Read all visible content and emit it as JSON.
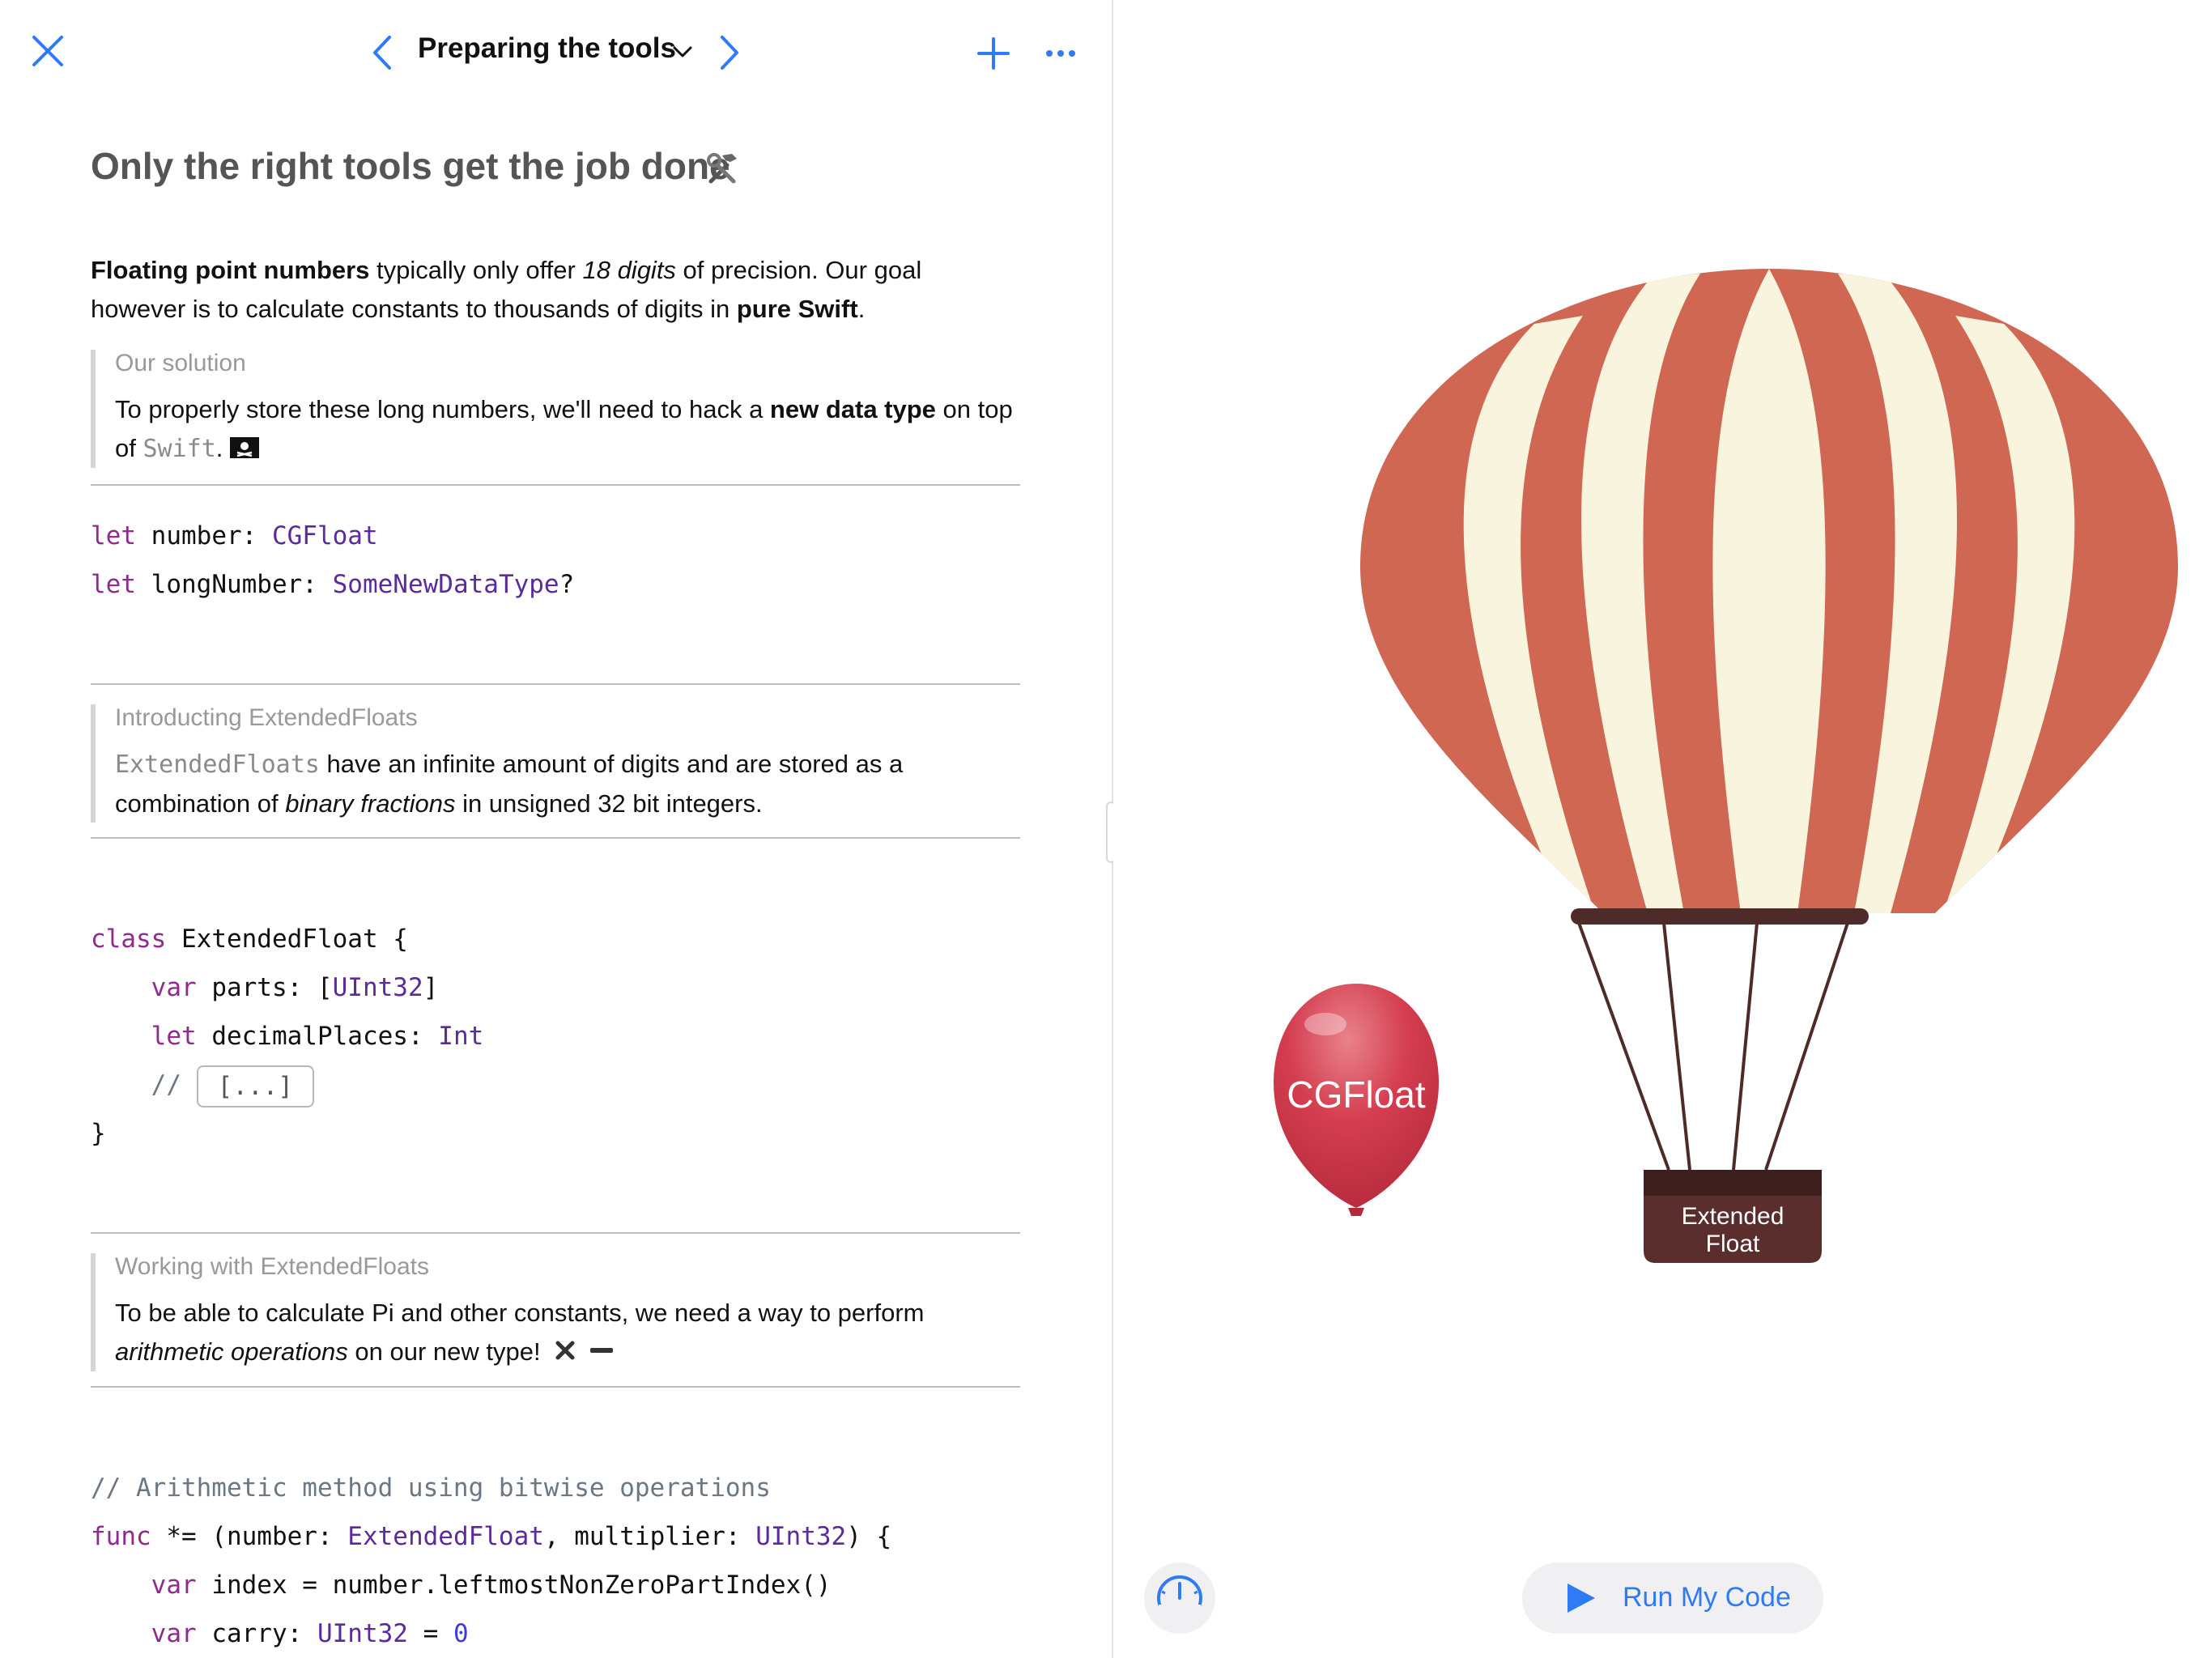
{
  "toolbar": {
    "title": "Preparing the tools",
    "accent_color": "#2f7bf5",
    "icons": [
      "close-icon",
      "chevron-left-icon",
      "chevron-down-icon",
      "chevron-right-icon",
      "plus-icon",
      "ellipsis-icon"
    ]
  },
  "page": {
    "heading": "Only the right tools get the job done",
    "heading_icon": "hammer-and-wrench-icon",
    "intro": {
      "p1_bold": "Floating point numbers",
      "p1_a": " typically only offer ",
      "p1_italic": "18 digits",
      "p1_b": " of precision. Our goal however is to calculate constants to thousands of digits in ",
      "p1_bold2": "pure Swift",
      "p1_c": "."
    },
    "callout1": {
      "title": "Our solution",
      "a": "To properly store these long numbers, we'll need to hack a ",
      "bold": "new data type",
      "b": " on top of ",
      "code": "Swift",
      "c": ".",
      "icon": "pirate-flag-icon"
    },
    "code1": {
      "l1_kw": "let",
      "l1_name": " number: ",
      "l1_type": "CGFloat",
      "l2_kw": "let",
      "l2_name": " longNumber: ",
      "l2_type": "SomeNewDataType",
      "l2_end": "?"
    },
    "callout2": {
      "title": "Introducting ExtendedFloats",
      "code": "ExtendedFloats",
      "a": " have an infinite amount of digits and are stored as a combination of ",
      "italic": "binary fractions",
      "b": " in unsigned 32 bit integers."
    },
    "code2": {
      "l1_kw": "class",
      "l1_rest": " ExtendedFloat {",
      "l2_kw": "var",
      "l2_name": " parts: [",
      "l2_type": "UInt32",
      "l2_end": "]",
      "l3_kw": "let",
      "l3_name": " decimalPlaces: ",
      "l3_type": "Int",
      "l4_comment": "//",
      "l4_placeholder": "[...]",
      "l5": "}"
    },
    "callout3": {
      "title": "Working with ExtendedFloats",
      "a": "To be able to calculate Pi and other constants, we need a way to perform ",
      "italic": "arithmetic operations",
      "b": " on our new type!",
      "icons": [
        "multiply-icon",
        "minus-icon"
      ]
    },
    "code3": {
      "l1": "// Arithmetic method using bitwise operations",
      "l2_kw": "func",
      "l2_a": " *= (number: ",
      "l2_type1": "ExtendedFloat",
      "l2_b": ", multiplier: ",
      "l2_type2": "UInt32",
      "l2_c": ") {",
      "l3_kw": "var",
      "l3_rest": " index = number.leftmostNonZeroPartIndex()",
      "l4_kw": "var",
      "l4_a": " carry: ",
      "l4_type": "UInt32",
      "l4_b": " = ",
      "l4_num": "0"
    }
  },
  "scene": {
    "balloon_label": "CGFloat",
    "basket_label_1": "Extended",
    "basket_label_2": "Float",
    "balloon_color": "#d23a4c",
    "stripe_red": "#cf6753",
    "stripe_cream": "#f8f4dd",
    "basket_color": "#5a2e2c"
  },
  "controls": {
    "run_label": "Run My Code",
    "run_icon": "play-icon",
    "meter_icon": "speedometer-icon"
  }
}
